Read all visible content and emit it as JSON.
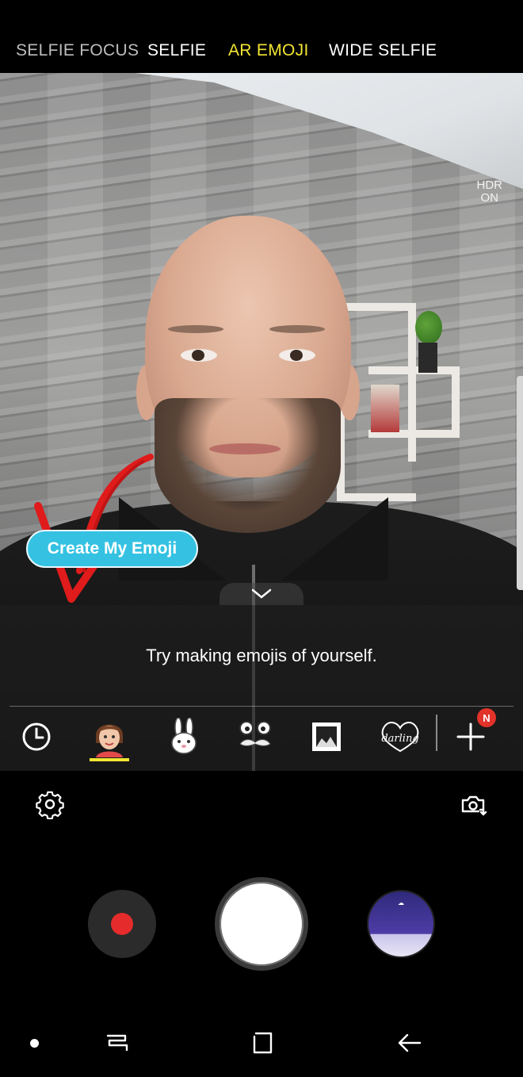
{
  "modes": [
    {
      "label": "SELFIE FOCUS",
      "state": "inactive"
    },
    {
      "label": "SELFIE",
      "state": "inactive"
    },
    {
      "label": "AR EMOJI",
      "state": "active"
    },
    {
      "label": "WIDE SELFIE",
      "state": "inactive"
    }
  ],
  "hdr": {
    "line1": "HDR",
    "line2": "ON"
  },
  "create_emoji_label": "Create My Emoji",
  "hint_text": "Try making emojis of yourself.",
  "stickers": [
    {
      "name": "recent",
      "icon": "clock-icon"
    },
    {
      "name": "my-emoji",
      "icon": "avatar-emoji-icon",
      "selected": true
    },
    {
      "name": "bunny",
      "icon": "bunny-sticker-icon"
    },
    {
      "name": "mustache-face",
      "icon": "mustache-sticker-icon"
    },
    {
      "name": "frame",
      "icon": "frame-sticker-icon"
    },
    {
      "name": "darling",
      "icon": "darling-heart-sticker-icon",
      "text": "darling"
    },
    {
      "name": "add",
      "icon": "plus-icon",
      "badge": "N"
    }
  ],
  "colors": {
    "active_mode": "#f2e533",
    "create_button": "#35c2e2",
    "record_dot": "#e52b2b",
    "badge": "#e2322a"
  }
}
